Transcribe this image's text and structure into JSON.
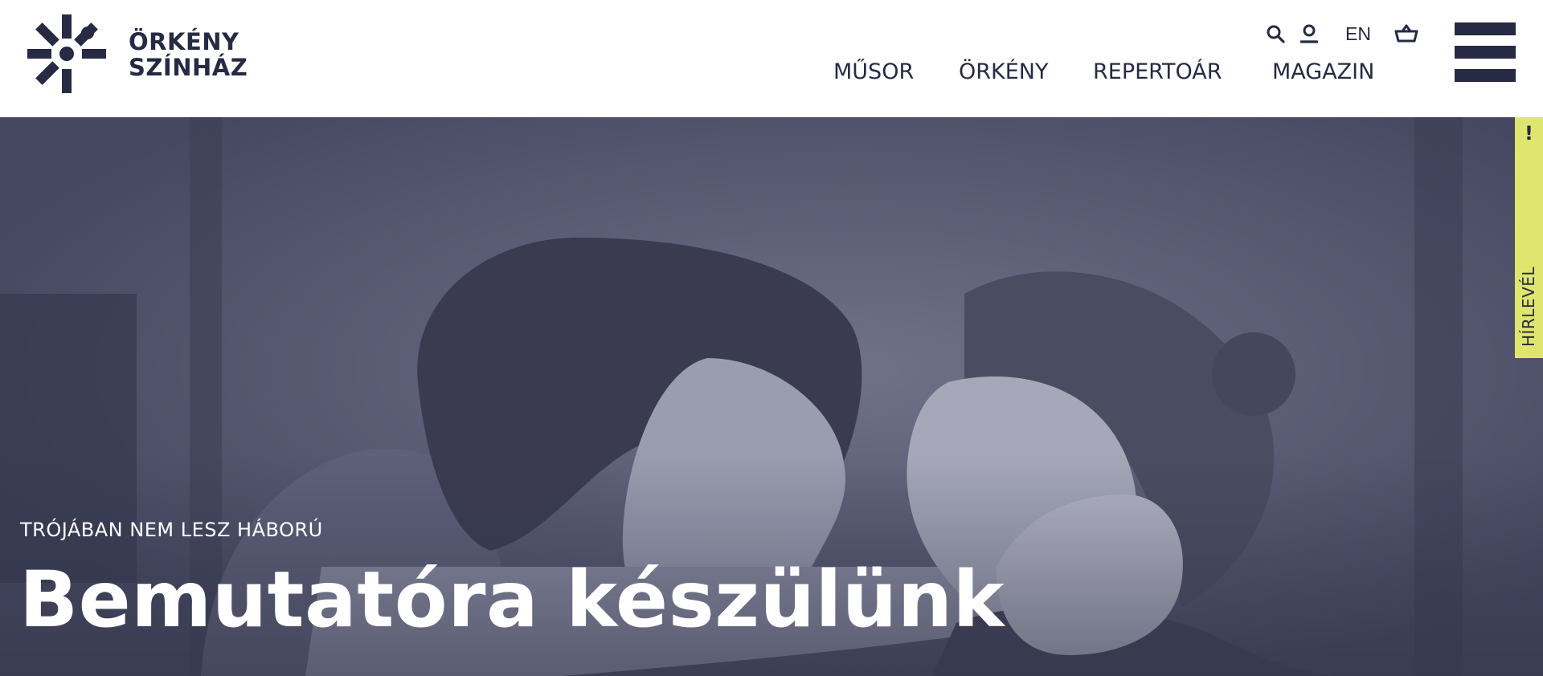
{
  "brand": {
    "line1": "ÖRKÉNY",
    "line2": "SZÍNHÁZ",
    "logo_icon": "orkeny-sunburst-logo",
    "color": "#262a44"
  },
  "utility": {
    "search_icon": "search-icon",
    "account_icon": "user-icon",
    "language_label": "EN",
    "basket_icon": "basket-icon"
  },
  "nav": {
    "items": [
      {
        "label": "MŰSOR"
      },
      {
        "label": "ÖRKÉNY"
      },
      {
        "label": "REPERTOÁR"
      },
      {
        "label": "MAGAZIN"
      }
    ],
    "menu_icon": "hamburger-menu-icon"
  },
  "hero": {
    "kicker": "TRÓJÁBAN NEM LESZ HÁBORÚ",
    "title": "Bemutatóra készülünk",
    "tint_color": "#4f5269"
  },
  "newsletter": {
    "mark": "!",
    "label": "HÍRLEVÉL",
    "color": "#dfe66d"
  }
}
